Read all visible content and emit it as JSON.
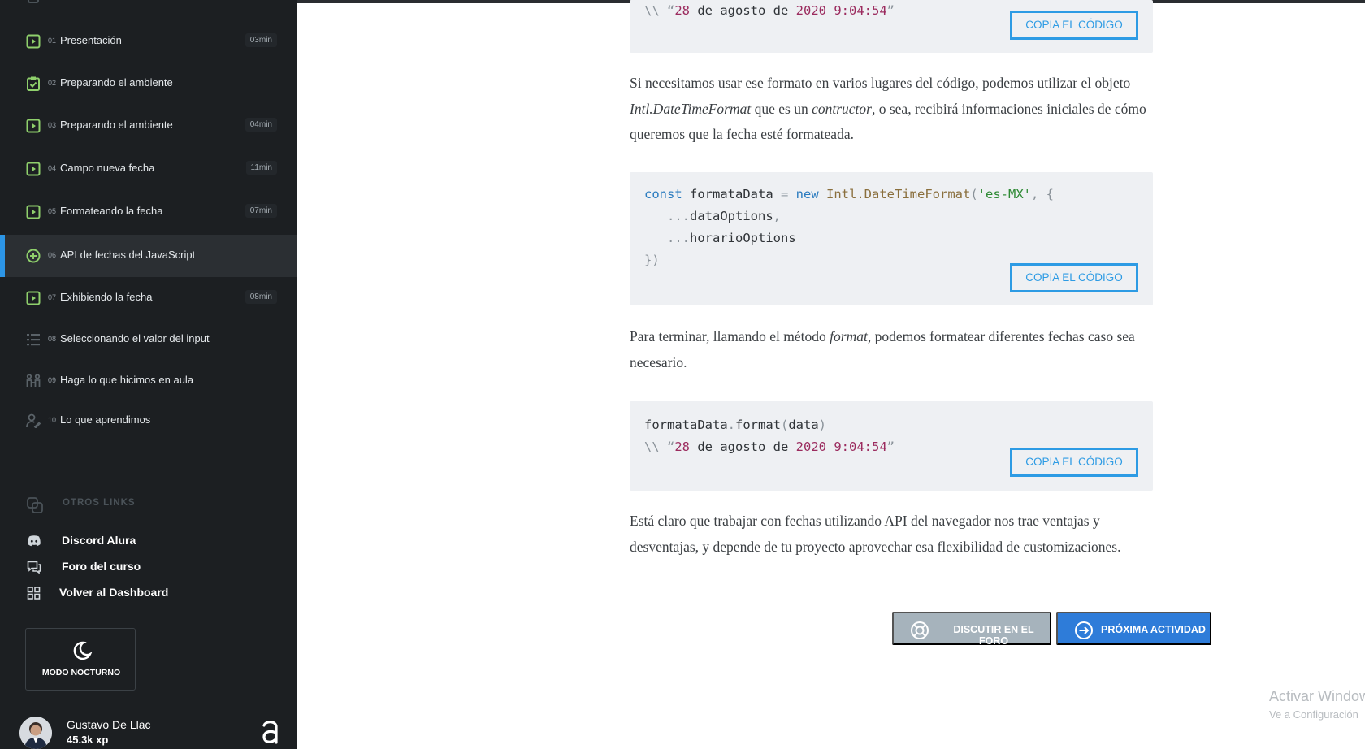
{
  "sidebar": {
    "lessons": [
      {
        "num": "01",
        "title": "Presentación",
        "time": "03min",
        "icon": "play-icon"
      },
      {
        "num": "02",
        "title": "Preparando el ambiente",
        "time": "",
        "icon": "clipboard-check-icon"
      },
      {
        "num": "03",
        "title": "Preparando el ambiente",
        "time": "04min",
        "icon": "play-icon"
      },
      {
        "num": "04",
        "title": "Campo nueva fecha",
        "time": "11min",
        "icon": "play-icon"
      },
      {
        "num": "05",
        "title": "Formateando la fecha",
        "time": "07min",
        "icon": "play-icon"
      },
      {
        "num": "06",
        "title": "API de fechas del JavaScript",
        "time": "",
        "icon": "plus-circle-icon",
        "active": true
      },
      {
        "num": "07",
        "title": "Exhibiendo la fecha",
        "time": "08min",
        "icon": "play-icon"
      },
      {
        "num": "08",
        "title": "Seleccionando el valor del input",
        "time": "",
        "icon": "list-icon"
      },
      {
        "num": "09",
        "title": "Haga lo que hicimos en aula",
        "time": "",
        "icon": "people-icon"
      },
      {
        "num": "10",
        "title": "Lo que aprendimos",
        "time": "",
        "icon": "user-edit-icon"
      }
    ],
    "others_title": "OTROS LINKS",
    "links": [
      {
        "label": "Discord Alura",
        "icon": "discord-icon"
      },
      {
        "label": "Foro del curso",
        "icon": "forum-icon"
      },
      {
        "label": "Volver al Dashboard",
        "icon": "dashboard-icon"
      }
    ],
    "night_mode_label": "MODO NOCTURNO",
    "user": {
      "name": "Gustavo De Llac",
      "xp": "45.3k xp"
    }
  },
  "content": {
    "copy_label": "COPIA EL CÓDIGO",
    "block1": {
      "prefix": "\\\\ “",
      "day": "28",
      "mid": " de agosto de ",
      "year": "2020",
      "time": "9:04:54",
      "suffix": "”"
    },
    "para1": {
      "t1": "Si necesitamos usar ese formato en varios lugares del código, podemos utilizar el objeto ",
      "em1": "Intl.DateTimeFormat",
      "t2": " que es un ",
      "em2": "contructor",
      "t3": ", o sea, recibirá informaciones iniciales de cómo queremos que la fecha esté formateada."
    },
    "block2": {
      "kw_const": "const",
      "var_name": " formataData ",
      "op_eq": "=",
      "kw_new": " new ",
      "fn_name": "Intl.DateTimeFormat",
      "paren_open": "(",
      "locale": "'es-MX'",
      "after_locale": ", {",
      "line2_dots": "   ...",
      "line2_name": "dataOptions",
      "line2_end": ",",
      "line3_dots": "   ...",
      "line3_name": "horarioOptions",
      "line4": "})"
    },
    "para2": {
      "t1": "Para terminar, llamando el método ",
      "em1": "format",
      "t2": ", podemos formatear diferentes fechas caso sea necesario."
    },
    "block3": {
      "line1_obj": "formataData",
      "line1_dot": ".",
      "line1_method": "format",
      "line1_open": "(",
      "line1_arg": "data",
      "line1_close": ")",
      "prefix": "\\\\ “",
      "day": "28",
      "mid": " de agosto de ",
      "year": "2020",
      "time": "9:04:54",
      "suffix": "”"
    },
    "para3": "Está claro que trabajar con fechas utilizando API del navegador nos trae ventajas y desventajas, y depende de tu proyecto aprovechar esa flexibilidad de customizaciones.",
    "btn_forum": "DISCUTIR EN EL FORO",
    "btn_next": "PRÓXIMA ACTIVIDAD"
  },
  "windows": {
    "activate": "Activar Windows",
    "config": "Ve a Configuración"
  }
}
